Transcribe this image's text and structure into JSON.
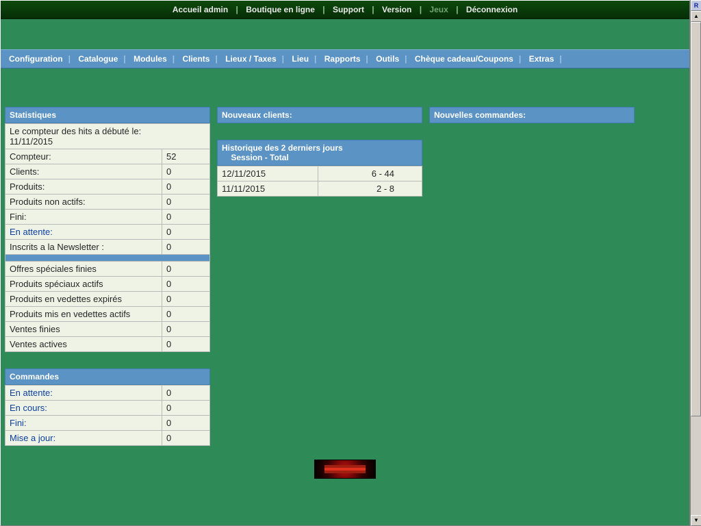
{
  "topnav": {
    "items": [
      {
        "label": "Accueil admin"
      },
      {
        "label": "Boutique en ligne"
      },
      {
        "label": "Support"
      },
      {
        "label": "Version"
      },
      {
        "label": "Jeux",
        "muted": true
      },
      {
        "label": "Déconnexion"
      }
    ]
  },
  "subnav": {
    "items": [
      {
        "label": "Configuration"
      },
      {
        "label": "Catalogue"
      },
      {
        "label": "Modules"
      },
      {
        "label": "Clients"
      },
      {
        "label": "Lieux / Taxes"
      },
      {
        "label": "Lieu"
      },
      {
        "label": "Rapports"
      },
      {
        "label": "Outils"
      },
      {
        "label": "Chèque cadeau/Coupons"
      },
      {
        "label": "Extras"
      }
    ]
  },
  "stats": {
    "title": "Statistiques",
    "started_label": "Le compteur des hits a débuté le:",
    "started_date": "11/11/2015",
    "rows": [
      {
        "label": "Compteur:",
        "value": "52"
      },
      {
        "label": "Clients:",
        "value": "0"
      },
      {
        "label": "Produits:",
        "value": "0"
      },
      {
        "label": "Produits non actifs:",
        "value": "0"
      },
      {
        "label": "Fini:",
        "value": "0"
      },
      {
        "label": "En attente:",
        "value": "0",
        "link": true
      },
      {
        "label": "Inscrits a la Newsletter :",
        "value": "0"
      }
    ],
    "rows2": [
      {
        "label": "Offres spéciales finies",
        "value": "0"
      },
      {
        "label": "Produits spéciaux actifs",
        "value": "0"
      },
      {
        "label": "Produits en vedettes expirés",
        "value": "0"
      },
      {
        "label": "Produits mis en vedettes actifs",
        "value": "0"
      },
      {
        "label": "Ventes finies",
        "value": "0"
      },
      {
        "label": "Ventes actives",
        "value": "0"
      }
    ]
  },
  "orders": {
    "title": "Commandes",
    "rows": [
      {
        "label": "En attente:",
        "value": "0",
        "link": true
      },
      {
        "label": "En cours:",
        "value": "0",
        "link": true
      },
      {
        "label": "Fini:",
        "value": "0",
        "link": true
      },
      {
        "label": "Mise a jour:",
        "value": "0",
        "link": true
      }
    ]
  },
  "newclients": {
    "title": "Nouveaux clients:",
    "history_title_l1": "Historique des 2 derniers jours",
    "history_title_l2": "Session - Total",
    "rows": [
      {
        "date": "12/11/2015",
        "value": "6 - 44"
      },
      {
        "date": "11/11/2015",
        "value": "2 - 8"
      }
    ]
  },
  "neworders": {
    "title": "Nouvelles commandes:"
  },
  "scroll": {
    "corner": "R",
    "up": "▲",
    "down": "▼"
  }
}
